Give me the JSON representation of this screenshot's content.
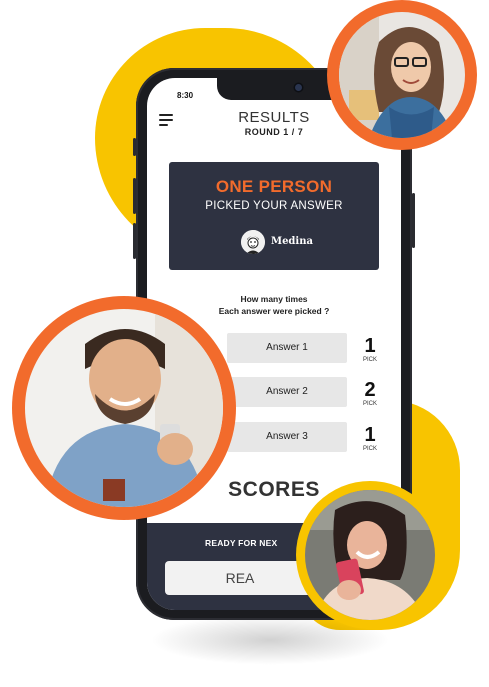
{
  "colors": {
    "accent_orange": "#F26B2C",
    "accent_yellow": "#F8C400",
    "card_dark": "#2E3241"
  },
  "status_bar": {
    "time": "8:30"
  },
  "header": {
    "title": "RESULTS",
    "round": "ROUND 1 / 7",
    "menu_icon": "hamburger-menu-icon"
  },
  "result_card": {
    "headline": "ONE PERSON",
    "subline": "PICKED YOUR ANSWER",
    "player_name": "Medina"
  },
  "stats": {
    "question_line1": "How many times",
    "question_line2": "Each answer were picked ?",
    "answers": [
      {
        "label": "Answer 1",
        "count": "1",
        "unit": "PICK"
      },
      {
        "label": "Answer 2",
        "count": "2",
        "unit": "PICK"
      },
      {
        "label": "Answer 3",
        "count": "1",
        "unit": "PICK"
      }
    ]
  },
  "scores_title": "SCORES",
  "footer": {
    "ready_text": "READY FOR NEX",
    "ready_button": "REA"
  }
}
